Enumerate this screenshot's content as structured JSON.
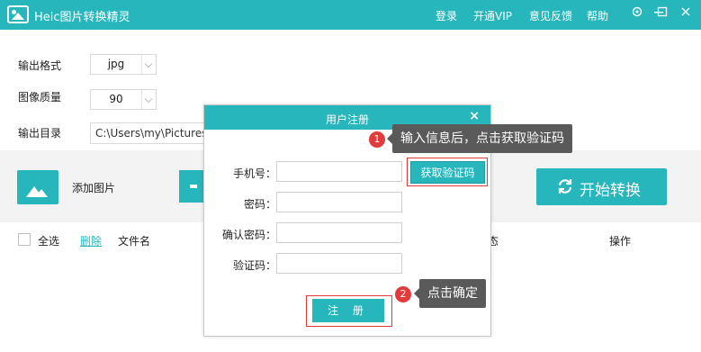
{
  "titlebar": {
    "app_title": "Heic图片转换精灵",
    "menu": [
      "登录",
      "开通VIP",
      "意见反馈",
      "帮助"
    ],
    "window_controls": [
      "settings-icon",
      "minimize-icon",
      "maximize-icon",
      "close-icon"
    ]
  },
  "settings": {
    "format_label": "输出格式",
    "format_value": "jpg",
    "quality_label": "图像质量",
    "quality_value": "90",
    "dir_label": "输出目录",
    "dir_value": "C:\\Users\\my\\Pictures\\"
  },
  "toolbar": {
    "add_label": "添加图片",
    "convert_label": "开始转换"
  },
  "list_header": {
    "select_all": "全选",
    "delete": "删除",
    "filename": "文件名",
    "status_partial": "态",
    "action": "操作"
  },
  "modal": {
    "title": "用户注册",
    "close_glyph": "×",
    "phone_label": "手机号：",
    "password_label": "密码：",
    "confirm_label": "确认密码：",
    "code_label": "验证码：",
    "get_code_button": "获取验证码",
    "register_button": "注 册"
  },
  "callouts": [
    {
      "number": "1",
      "text": "输入信息后，点击获取验证码"
    },
    {
      "number": "2",
      "text": "点击确定"
    }
  ],
  "colors": {
    "accent": "#27b6bc",
    "highlight": "#e23b3b",
    "callout_bg": "#5a5a5a"
  }
}
